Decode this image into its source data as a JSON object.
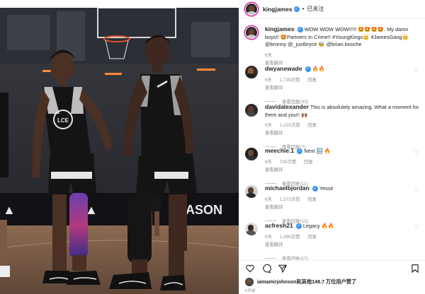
{
  "post": {
    "author": "kingjames",
    "verified_mark": "✓",
    "follow_label": "已关注",
    "caption_text": "WOW WOW WOW!!!!! 🤩🤩🤩🤩. My damn boys!! 🤩Partners In Crime!! #YoungKings👑 #JamesGang👑",
    "caption_mentions": "@bronny @_justbryce 🐝 @brian.bosche",
    "caption_time": "6天",
    "caption_translate": "查看翻译"
  },
  "comments": [
    {
      "user": "dwyanewade",
      "text": "🔥🔥",
      "time": "6天",
      "likes": "1,739次赞",
      "reply": "回复",
      "translate": "查看翻译",
      "replies": "查看回复(33)"
    },
    {
      "user": "davidalexander",
      "text": "This is absolutely amazing. What a moment for them and you!! 🙌🏾",
      "time": "6天",
      "likes": "1,223次赞",
      "reply": "回复",
      "translate": "查看翻译",
      "replies": "查看回复(7)"
    },
    {
      "user": "meechie.1",
      "text": "Next 🔜 🔥",
      "time": "6天",
      "likes": "730次赞",
      "reply": "回复",
      "translate": "查看翻译",
      "replies": "查看回复(11)"
    },
    {
      "user": "michaelbjordan",
      "text": "Yessir",
      "time": "6天",
      "likes": "1,573次赞",
      "reply": "回复",
      "translate": "查看翻译",
      "replies": "查看回复(12)"
    },
    {
      "user": "acfresh21",
      "text": "Legacy 🔥🔥",
      "time": "6天",
      "likes": "1,090次赞",
      "reply": "回复",
      "translate": "查看翻译",
      "replies": "查看回复(17)"
    }
  ],
  "likes": {
    "text": "iamamirjohnson和其他148.7 万位用户赞了"
  },
  "date": "6天前",
  "icons": {
    "like": "heart-icon",
    "comment": "comment-icon",
    "share": "share-icon",
    "save": "bookmark-icon",
    "more": "more-icon"
  },
  "colors": {
    "link": "#00376b",
    "verified": "#3897f0",
    "muted": "#8e8e8e",
    "story_ring": "#d6249f"
  },
  "photo": {
    "jersey_text_left": "LCE",
    "banner_text": "ASON"
  }
}
